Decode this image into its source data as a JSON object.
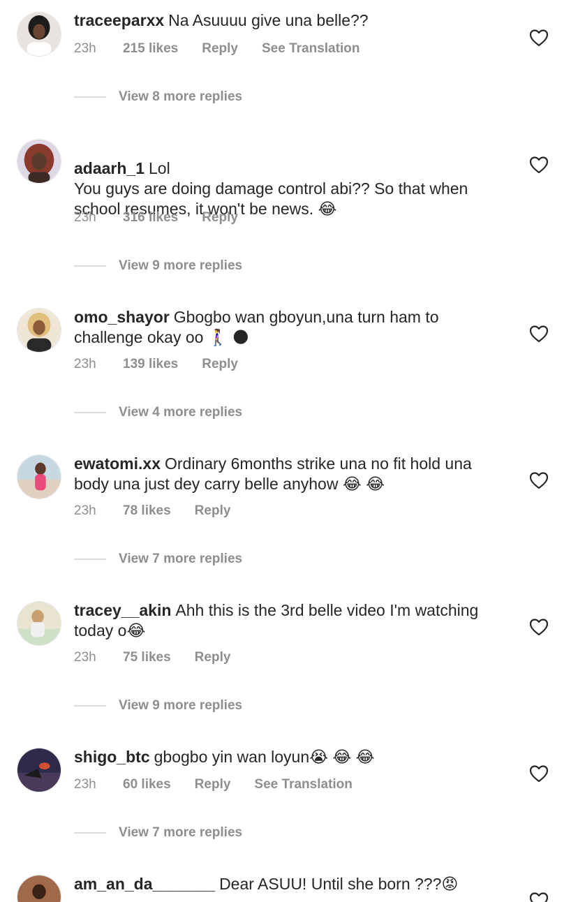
{
  "comments": [
    {
      "username": "traceeparxx",
      "text": "Na Asuuuu give una belle??",
      "time": "23h",
      "likes": "215 likes",
      "reply": "Reply",
      "translate": "See Translation",
      "view_replies": "View 8 more replies",
      "avatar_color": "#3b3b3b"
    },
    {
      "username": "adaarh_1",
      "text": "Lol\nYou guys are doing damage control abi?? So that when school resumes, it won't be news. 😂",
      "time": "23h",
      "likes": "316 likes",
      "reply": "Reply",
      "view_replies": "View 9 more replies",
      "avatar_color": "#8a4a3c"
    },
    {
      "username": "omo_shayor",
      "text": "Gbogbo wan gboyun,una turn ham to challenge okay oo 🚶‍♀️ 🌑",
      "time": "23h",
      "likes": "139 likes",
      "reply": "Reply",
      "view_replies": "View 4 more replies",
      "avatar_color": "#c9a27a"
    },
    {
      "username": "ewatomi.xx",
      "text": "Ordinary 6months strike una no fit hold una body una just dey carry belle anyhow 😂 😂",
      "time": "23h",
      "likes": "78 likes",
      "reply": "Reply",
      "view_replies": "View 7 more replies",
      "avatar_color": "#d96a8a"
    },
    {
      "username": "tracey__akin",
      "text": "Ahh this is the 3rd belle video I'm watching today o😂",
      "time": "23h",
      "likes": "75 likes",
      "reply": "Reply",
      "view_replies": "View 9 more replies",
      "avatar_color": "#d8d0b8"
    },
    {
      "username": "shigo_btc",
      "text": "gbogbo yin wan loyun😭 😂 😂",
      "time": "23h",
      "likes": "60 likes",
      "reply": "Reply",
      "translate": "See Translation",
      "view_replies": "View 7 more replies",
      "avatar_color": "#2e2a4a"
    },
    {
      "username": "am_an_da_______",
      "text": "Dear ASUU! Until she born ???😡",
      "avatar_color": "#6b3a22"
    }
  ],
  "colors": {
    "text": "#262626",
    "meta": "#8e8e8e",
    "divider": "#dbdbdb"
  },
  "icons": {
    "heart": "heart-outline-icon"
  }
}
